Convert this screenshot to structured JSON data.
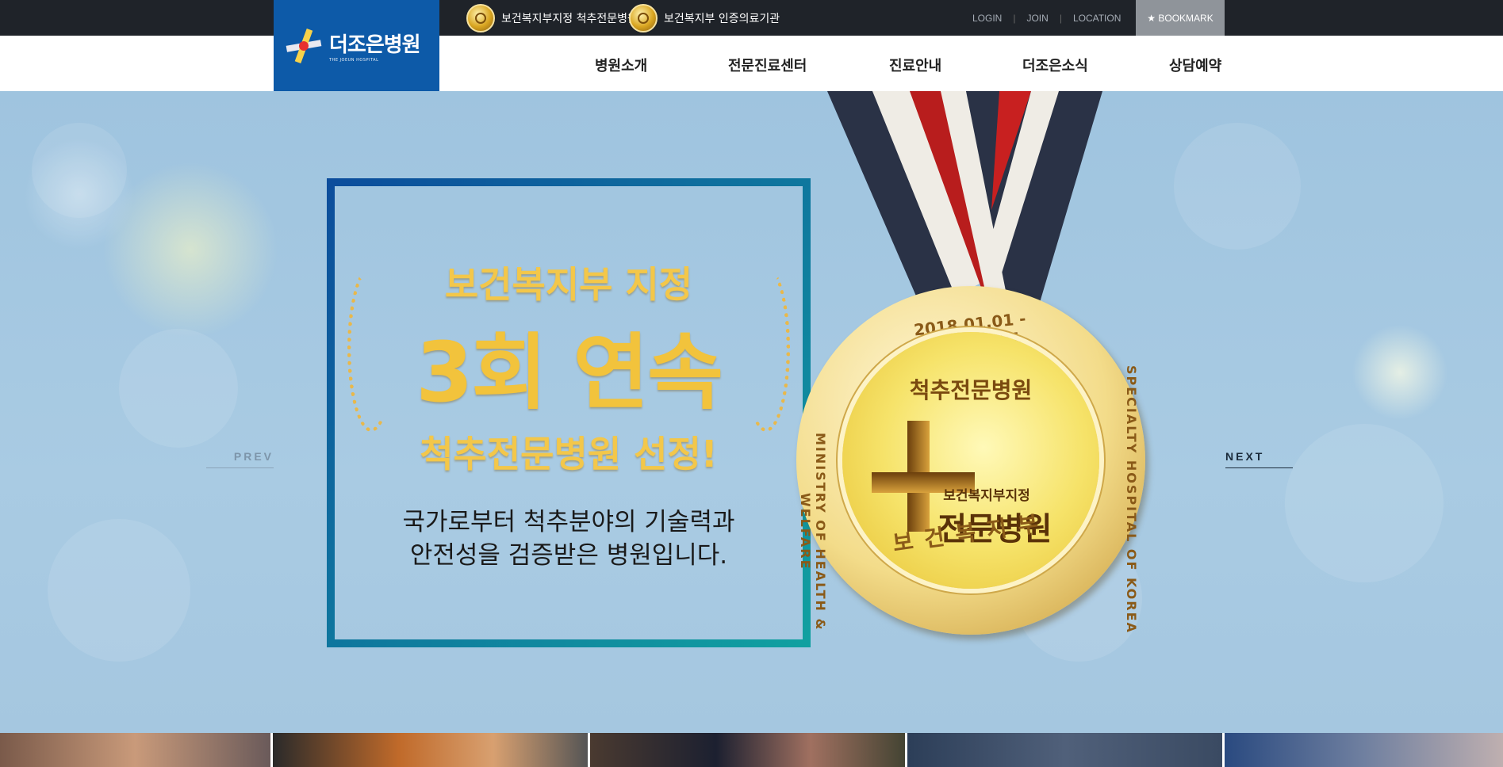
{
  "topbar": {
    "cert1": "보건복지부지정 척추전문병원",
    "cert2": "보건복지부 인증의료기관",
    "links": [
      "LOGIN",
      "JOIN",
      "LOCATION"
    ],
    "separator": "|",
    "bookmark": "★ BOOKMARK"
  },
  "logo": {
    "name": "더조은병원",
    "sub": "THE JOEUN HOSPITAL"
  },
  "nav": [
    "병원소개",
    "전문진료센터",
    "진료안내",
    "더조은소식",
    "상담예약"
  ],
  "hero": {
    "line1": "보건복지부 지정",
    "big": "3회 연속",
    "line3": "척추전문병원 선정!",
    "desc1": "국가로부터 척추분야의 기술력과",
    "desc2": "안전성을 검증받은 병원입니다.",
    "prev": "PREV",
    "next": "NEXT"
  },
  "medal": {
    "date": "2018.01.01 - 2020.12.31",
    "specialty": "척추전문병원",
    "ministry": "보건복지부",
    "left_text": "MINISTRY OF HEALTH & WELFARE",
    "right_text": "SPECIALTY HOSPITAL OF KOREA",
    "designation": "보건복지부지정",
    "hospital": "전문병원"
  },
  "colors": {
    "topbar": "#1f2329",
    "logo_bg": "#0d5aa8",
    "gold": "#f2c33c",
    "frame_start": "#0c4d9c",
    "frame_end": "#11a0a0"
  }
}
